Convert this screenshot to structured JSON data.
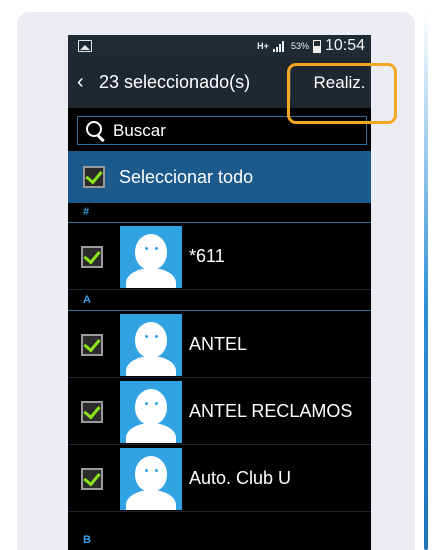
{
  "status_bar": {
    "network": "H+",
    "battery_percent": "53%",
    "battery_level": 0.53,
    "time": "10:54"
  },
  "action_bar": {
    "back_icon": "chevron-left-icon",
    "title": "23 seleccionado(s)",
    "done_label": "Realiz."
  },
  "search": {
    "icon": "search-icon",
    "placeholder": "Buscar"
  },
  "select_all": {
    "label": "Seleccionar todo",
    "checked": true
  },
  "contacts": [
    {
      "section": "#"
    },
    {
      "name": "*611",
      "checked": true
    },
    {
      "section": "A"
    },
    {
      "name": "ANTEL",
      "checked": true
    },
    {
      "name": "ANTEL RECLAMOS",
      "checked": true
    },
    {
      "name": "Auto. Club U",
      "checked": true
    },
    {
      "section": "B"
    }
  ],
  "colors": {
    "accent_blue": "#1c5a8c",
    "section_blue": "#3b9ee6",
    "check_green": "#8ce21d",
    "avatar_blue": "#31a3e3",
    "highlight_orange": "#f5a623"
  }
}
